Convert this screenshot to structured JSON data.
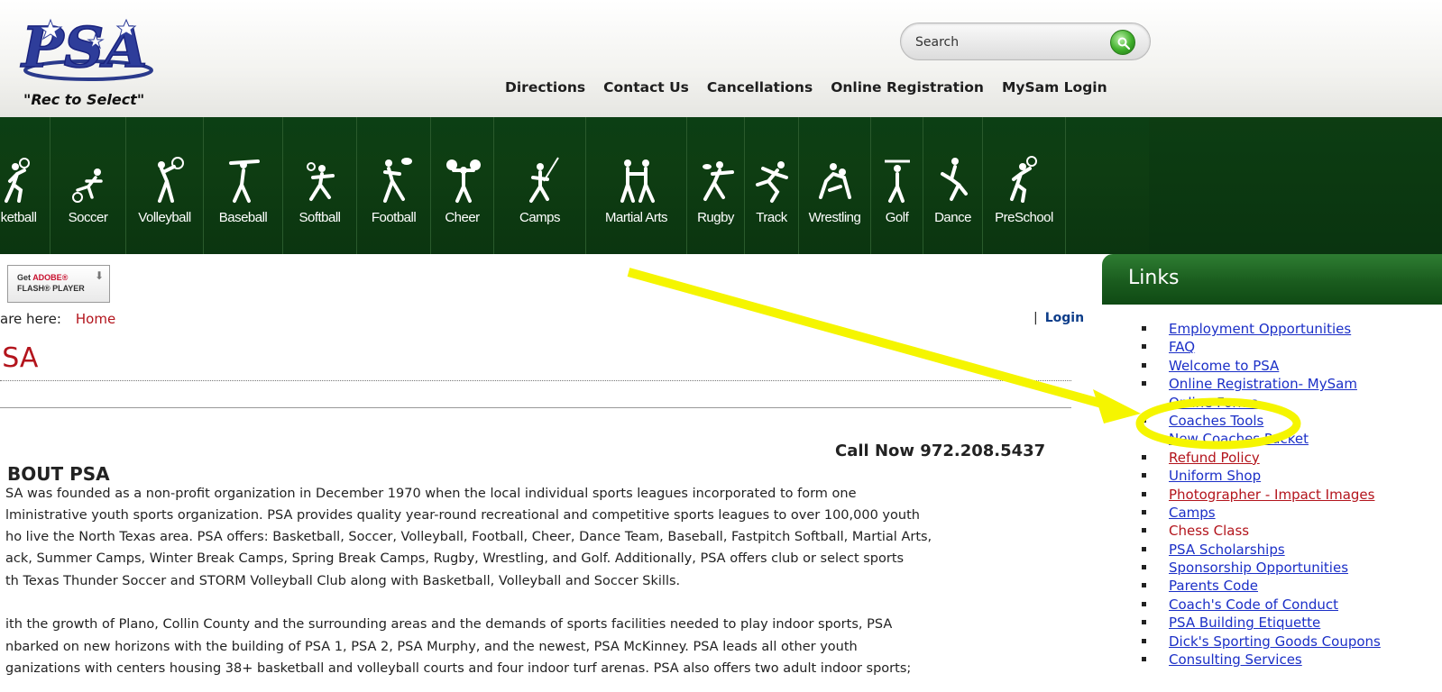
{
  "header": {
    "tagline": "\"Rec to Select\"",
    "search_placeholder": "Search",
    "nav": [
      "Directions",
      "Contact Us",
      "Cancellations",
      "Online Registration",
      "MySam Login"
    ]
  },
  "sports": [
    {
      "label": "ketball",
      "icon": "basketball-icon"
    },
    {
      "label": "Soccer",
      "icon": "soccer-icon"
    },
    {
      "label": "Volleyball",
      "icon": "volleyball-icon"
    },
    {
      "label": "Baseball",
      "icon": "baseball-icon"
    },
    {
      "label": "Softball",
      "icon": "softball-icon"
    },
    {
      "label": "Football",
      "icon": "football-icon"
    },
    {
      "label": "Cheer",
      "icon": "cheer-icon"
    },
    {
      "label": "Camps",
      "icon": "camps-icon"
    },
    {
      "label": "Martial Arts",
      "icon": "martial-arts-icon"
    },
    {
      "label": "Rugby",
      "icon": "rugby-icon"
    },
    {
      "label": "Track",
      "icon": "track-icon"
    },
    {
      "label": "Wrestling",
      "icon": "wrestling-icon"
    },
    {
      "label": "Golf",
      "icon": "golf-icon"
    },
    {
      "label": "Dance",
      "icon": "dance-icon"
    },
    {
      "label": "PreSchool",
      "icon": "preschool-icon"
    }
  ],
  "main": {
    "flash_line1_a": "Get",
    "flash_line1_b": "ADOBE®",
    "flash_line2": "FLASH® PLAYER",
    "breadcrumb_prefix": "are here:",
    "breadcrumb_home": "Home",
    "login_separator": "|",
    "login_label": "Login",
    "page_title": "'SA",
    "call_now": "Call Now  972.208.5437",
    "about_heading": "BOUT PSA",
    "paragraph1": [
      "SA was founded as a non-profit organization in December 1970 when the local individual sports leagues incorporated to form one",
      "lministrative youth sports organization.  PSA provides quality year-round recreational and competitive sports leagues to over 100,000 youth",
      "ho live the North Texas area.  PSA offers: Basketball, Soccer, Volleyball, Football, Cheer, Dance Team, Baseball, Fastpitch Softball, Martial Arts,",
      "ack, Summer Camps, Winter Break Camps, Spring Break Camps, Rugby, Wrestling, and Golf.  Additionally, PSA offers club or select sports",
      "th Texas Thunder Soccer and STORM Volleyball Club along with Basketball, Volleyball and Soccer Skills."
    ],
    "paragraph2": [
      "ith the growth of Plano, Collin County and the surrounding areas and the demands of sports facilities needed to play indoor sports, PSA",
      "nbarked on new horizons with the building of PSA 1, PSA 2, PSA Murphy, and the newest, PSA McKinney.  PSA leads all other youth",
      "ganizations with centers housing 38+ basketball and volleyball courts and four indoor turf arenas.  PSA also offers two adult indoor sports;"
    ]
  },
  "sidebar": {
    "title": "Links",
    "links": [
      {
        "label": "Employment Opportunities",
        "style": "blue"
      },
      {
        "label": "FAQ",
        "style": "blue"
      },
      {
        "label": "Welcome to PSA",
        "style": "blue"
      },
      {
        "label": "Online Registration- MySam",
        "style": "blue"
      },
      {
        "label": "Online Forms",
        "style": "blue"
      },
      {
        "label": "Coaches Tools",
        "style": "blue"
      },
      {
        "label": "New Coaches Packet",
        "style": "blue"
      },
      {
        "label": "Refund Policy",
        "style": "red"
      },
      {
        "label": "Uniform Shop",
        "style": "blue"
      },
      {
        "label": "Photographer - Impact Images",
        "style": "red"
      },
      {
        "label": "Camps",
        "style": "blue"
      },
      {
        "label": "Chess Class",
        "style": "red-plain"
      },
      {
        "label": "PSA Scholarships",
        "style": "blue"
      },
      {
        "label": "Sponsorship Opportunities",
        "style": "blue"
      },
      {
        "label": "Parents Code",
        "style": "blue"
      },
      {
        "label": "Coach's Code of Conduct",
        "style": "blue"
      },
      {
        "label": "PSA Building Etiquette",
        "style": "blue"
      },
      {
        "label": "Dick's Sporting Goods Coupons",
        "style": "blue"
      },
      {
        "label": "Consulting Services",
        "style": "blue"
      }
    ]
  },
  "colors": {
    "brand_green": "#0c3f14",
    "link_blue": "#1b2fc7",
    "accent_red": "#b3141c",
    "annotation_yellow": "#f5f500"
  }
}
